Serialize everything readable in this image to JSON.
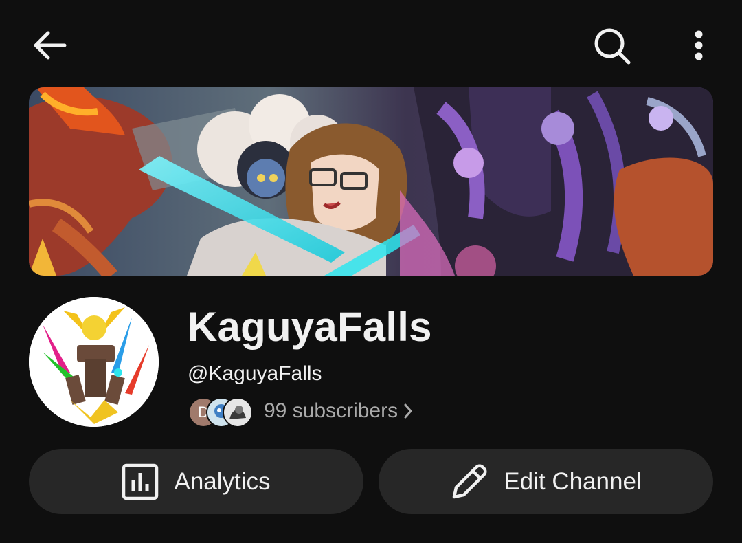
{
  "topbar": {
    "back_icon": "arrow-left-icon",
    "search_icon": "search-icon",
    "more_icon": "more-vertical-icon"
  },
  "channel": {
    "name": "KaguyaFalls",
    "handle": "@KaguyaFalls",
    "subscribers": "99 subscribers",
    "subscriber_avatar_initial": "D"
  },
  "actions": {
    "analytics_label": "Analytics",
    "analytics_icon": "analytics-icon",
    "edit_label": "Edit Channel",
    "edit_icon": "pencil-icon"
  },
  "colors": {
    "background": "#0f0f0f",
    "pill": "#272727",
    "text": "#f1f1f1",
    "secondary_text": "#aaaaaa"
  }
}
